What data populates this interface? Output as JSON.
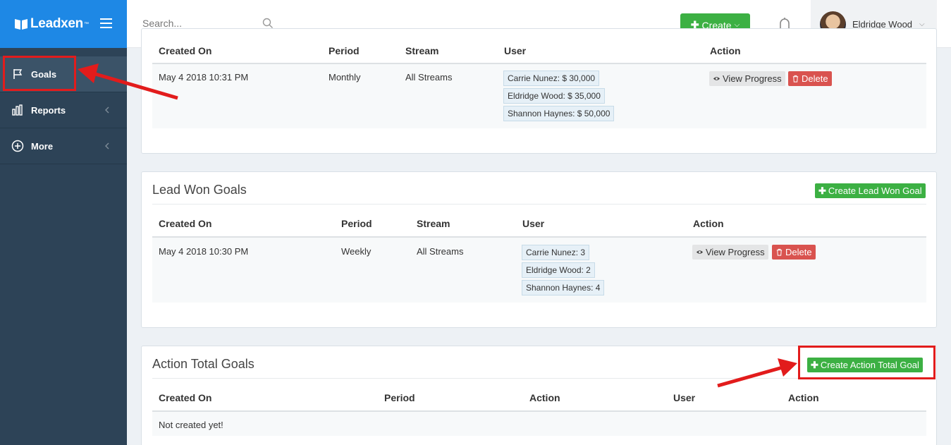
{
  "brand": {
    "name": "Leadxen",
    "tm": "™"
  },
  "sidebar": {
    "items": [
      {
        "label": "Goals"
      },
      {
        "label": "Reports"
      },
      {
        "label": "More"
      }
    ]
  },
  "header": {
    "search_placeholder": "Search...",
    "create_label": "Create",
    "user_name": "Eldridge Wood"
  },
  "revenue_goals": {
    "columns": [
      "Created On",
      "Period",
      "Stream",
      "User",
      "Action"
    ],
    "row": {
      "created_on": "May 4 2018 10:31 PM",
      "period": "Monthly",
      "stream": "All Streams",
      "users": [
        "Carrie Nunez: $ 30,000",
        "Eldridge Wood: $ 35,000",
        "Shannon Haynes: $ 50,000"
      ],
      "view_label": "View Progress",
      "delete_label": "Delete"
    }
  },
  "lead_won_goals": {
    "title": "Lead Won Goals",
    "create_label": "Create Lead Won Goal",
    "columns": [
      "Created On",
      "Period",
      "Stream",
      "User",
      "Action"
    ],
    "row": {
      "created_on": "May 4 2018 10:30 PM",
      "period": "Weekly",
      "stream": "All Streams",
      "users": [
        "Carrie Nunez: 3",
        "Eldridge Wood: 2",
        "Shannon Haynes: 4"
      ],
      "view_label": "View Progress",
      "delete_label": "Delete"
    }
  },
  "action_total_goals": {
    "title": "Action Total Goals",
    "create_label": "Create Action Total Goal",
    "columns": [
      "Created On",
      "Period",
      "Action",
      "User",
      "Action"
    ],
    "empty_text": "Not created yet!"
  },
  "colors": {
    "brand_blue": "#1e88e5",
    "sidebar_bg": "#2d4357",
    "success_green": "#3cb043",
    "danger_red": "#d9534f",
    "annotation_red": "#e21c1c"
  }
}
